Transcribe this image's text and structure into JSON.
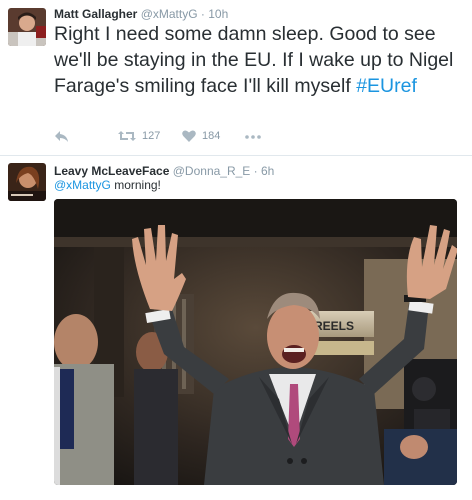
{
  "tweets": [
    {
      "author_name": "Matt Gallagher",
      "author_handle": "@xMattyG",
      "separator": "·",
      "time": "10h",
      "text_main": "Right I need some damn sleep. Good to see we'll be staying in the EU. If I wake up to Nigel Farage's smiling face I'll kill myself ",
      "hashtag": "#EUref",
      "actions": {
        "reply_icon": "reply-icon",
        "retweet_icon": "retweet-icon",
        "retweet_count": "127",
        "like_icon": "heart-icon",
        "like_count": "184",
        "more_icon": "more-dots-icon"
      }
    },
    {
      "author_name": "Leavy McLeaveFace",
      "author_handle": "@Donna_R_E",
      "separator": "·",
      "time": "6h",
      "mention": "@xMattyG",
      "text_rest": " morning!",
      "photo_sign": "REELS"
    }
  ],
  "colors": {
    "link": "#1b95e0",
    "muted": "#8899a6",
    "text": "#292f33",
    "icon": "#aab8c2"
  }
}
